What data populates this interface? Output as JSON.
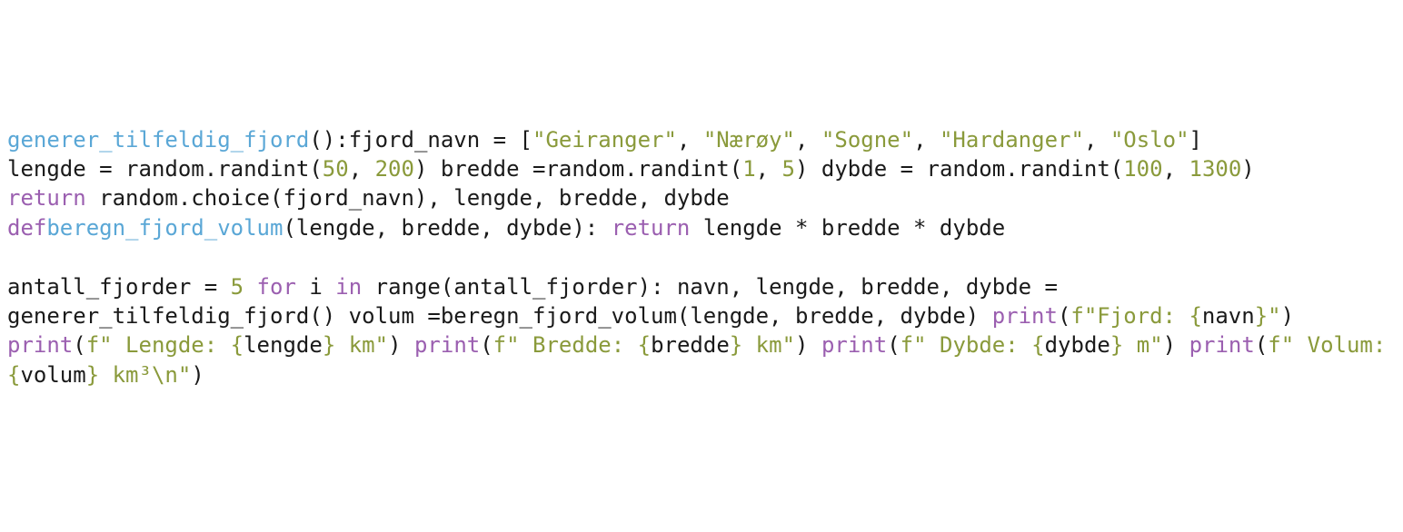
{
  "code": {
    "t01": "generer_tilfeldig_fjord",
    "t02": "():",
    "t03": "fjord_navn = [",
    "t04": "\"Geiranger\"",
    "t05": ", ",
    "t06": "\"Nærøy\"",
    "t07": ", ",
    "t08": "\"Sogne\"",
    "t09": ", ",
    "t10": "\"Hardanger\"",
    "t11": ", ",
    "t12": "\"Oslo\"",
    "t13": "]",
    "t14": "lengde = random.randint(",
    "t15": "50",
    "t16": ", ",
    "t17": "200",
    "t18": ") bredde =random.randint(",
    "t19": "1",
    "t20": ", ",
    "t21": "5",
    "t22": ") dybde = random.randint(",
    "t23": "100",
    "t24": ", ",
    "t25": "1300",
    "t26": ")",
    "t27": "return",
    "t28": " random.choice(fjord_navn), lengde, bredde, dybde",
    "t29": "def",
    "t30": "beregn_fjord_volum",
    "t31": "(lengde, bredde, dybde): ",
    "t32": "return",
    "t33": " lengde * bredde * dybde",
    "t34": "antall_fjorder = ",
    "t35": "5",
    "t36": " ",
    "t37": "for",
    "t38": " i ",
    "t39": "in",
    "t40": " ",
    "t41": "range",
    "t42": "(antall_fjorder): navn, lengde, bredde, dybde = generer_tilfeldig_fjord() volum =beregn_fjord_volum(lengde, bredde, dybde) ",
    "t43": "print",
    "t44": "(",
    "t45": "f\"Fjord: ",
    "t46": "{",
    "t47": "navn",
    "t48": "}",
    "t49": "\"",
    "t50": ") ",
    "t51": "print",
    "t52": "(",
    "t53": "f\" Lengde: ",
    "t54": "{",
    "t55": "lengde",
    "t56": "}",
    "t57": " km\"",
    "t58": ") ",
    "t59": "print",
    "t60": "(",
    "t61": "f\" Bredde: ",
    "t62": "{",
    "t63": "bredde",
    "t64": "}",
    "t65": " km\"",
    "t66": ") ",
    "t67": "print",
    "t68": "(",
    "t69": "f\" Dybde: ",
    "t70": "{",
    "t71": "dybde",
    "t72": "}",
    "t73": " m\"",
    "t74": ") ",
    "t75": "print",
    "t76": "(",
    "t77": "f\" Volum: ",
    "t78": "{",
    "t79": "volum",
    "t80": "}",
    "t81": " km³\\n\"",
    "t82": ")"
  }
}
